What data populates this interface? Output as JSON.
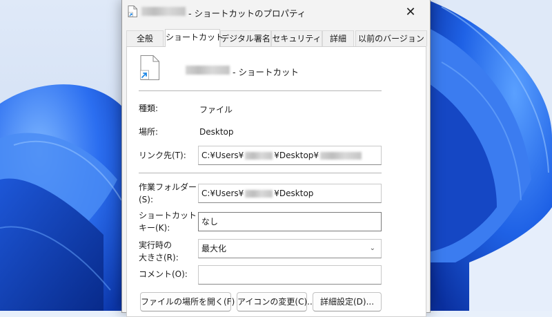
{
  "window": {
    "title": "- ショートカットのプロパティ",
    "close_symbol": "✕"
  },
  "tabs": [
    {
      "label": "全般",
      "active": false
    },
    {
      "label": "ショートカット",
      "active": true
    },
    {
      "label": "デジタル署名",
      "active": false
    },
    {
      "label": "セキュリティ",
      "active": false
    },
    {
      "label": "詳細",
      "active": false
    },
    {
      "label": "以前のバージョン",
      "active": false
    }
  ],
  "shortcut": {
    "name_suffix": "- ショートカット",
    "type_label": "種類:",
    "type_value": "ファイル",
    "location_label": "場所:",
    "location_value": "Desktop",
    "target_label": "リンク先(T):",
    "target_prefix": "C:¥Users¥",
    "target_middle": "¥Desktop¥",
    "start_in_label_1": "作業フォルダー",
    "start_in_label_2": "(S):",
    "start_in_prefix": "C:¥Users¥",
    "start_in_suffix": "¥Desktop",
    "hotkey_label_1": "ショートカット",
    "hotkey_label_2": "キー(K):",
    "hotkey_value": "なし",
    "run_label_1": "実行時の",
    "run_label_2": "大きさ(R):",
    "run_value": "最大化",
    "comment_label": "コメント(O):",
    "comment_value": ""
  },
  "buttons": {
    "open_location": "ファイルの場所を開く(F)",
    "change_icon": "アイコンの変更(C)...",
    "advanced": "詳細設定(D)..."
  },
  "icons": {
    "file": "shortcut-file-icon",
    "title": "shortcut-file-icon",
    "close": "close-icon",
    "dropdown": "chevron-down-icon"
  },
  "colors": {
    "accent": "#0067c0",
    "wallpaper_blue": "#1a5fe0"
  }
}
